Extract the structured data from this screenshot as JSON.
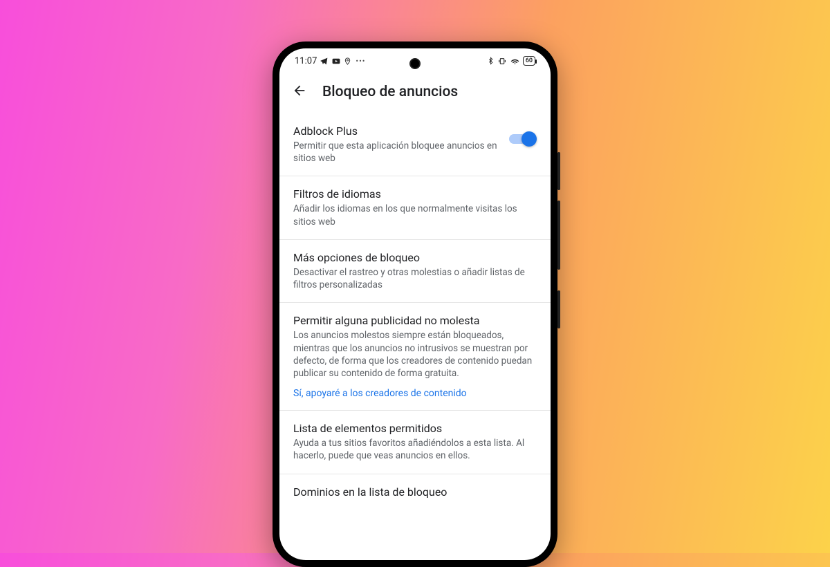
{
  "status": {
    "time": "11:07",
    "battery": "60"
  },
  "header": {
    "title": "Bloqueo de anuncios"
  },
  "items": [
    {
      "title": "Adblock Plus",
      "subtitle": "Permitir que esta aplicación bloquee anuncios en sitios web",
      "toggle": true
    },
    {
      "title": "Filtros de idiomas",
      "subtitle": "Añadir los idiomas en los que normalmente visitas los sitios web"
    },
    {
      "title": "Más opciones de bloqueo",
      "subtitle": "Desactivar el rastreo y otras molestias o añadir listas de filtros personalizadas"
    },
    {
      "title": "Permitir alguna publicidad no molesta",
      "subtitle": "Los anuncios molestos siempre están bloqueados, mientras que los anuncios no intrusivos se muestran por defecto, de forma que los creadores de contenido puedan publicar su contenido de forma gratuita.",
      "link": "Sí, apoyaré a los creadores de contenido"
    },
    {
      "title": "Lista de elementos permitidos",
      "subtitle": "Ayuda a tus sitios favoritos añadiéndolos a esta lista. Al hacerlo, puede que veas anuncios en ellos."
    },
    {
      "title": "Dominios en la lista de bloqueo",
      "subtitle": ""
    }
  ]
}
